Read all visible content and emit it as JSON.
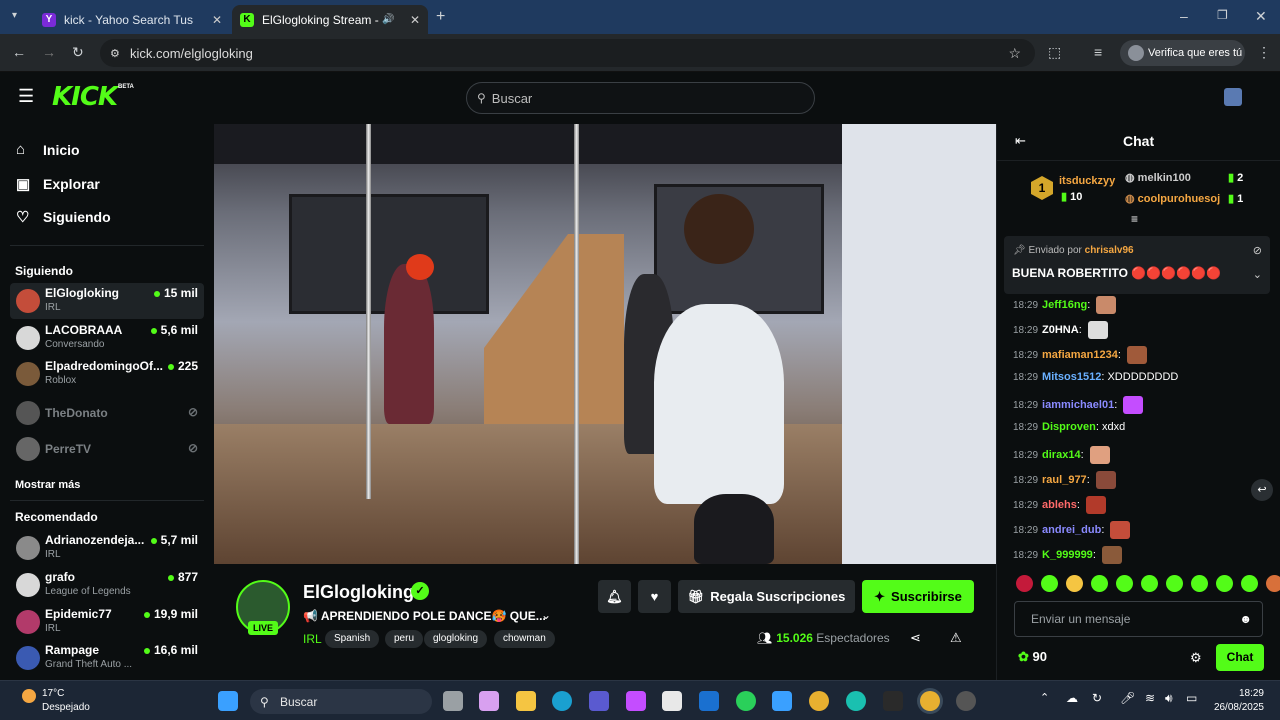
{
  "browser": {
    "tabs": [
      {
        "title": "kick - Yahoo Search Tus resultados",
        "favicon": "Y"
      },
      {
        "title": "ElGlogloking Stream - Watch",
        "favicon": "K"
      }
    ],
    "url": "kick.com/elglogloking",
    "verify_label": "Verifica que eres tú"
  },
  "header": {
    "logo": "KICK",
    "beta": "BETA",
    "search_placeholder": "Buscar"
  },
  "sidebar": {
    "nav": [
      {
        "label": "Inicio",
        "icon": "home-icon"
      },
      {
        "label": "Explorar",
        "icon": "explore-icon"
      },
      {
        "label": "Siguiendo",
        "icon": "heart-icon"
      }
    ],
    "following_title": "Siguiendo",
    "following": [
      {
        "name": "ElGlogloking",
        "category": "IRL",
        "viewers": "15 mil",
        "color": "#c44d3a"
      },
      {
        "name": "LACOBRAAA",
        "category": "Conversando",
        "viewers": "5,6 mil",
        "color": "#d8d8d8"
      },
      {
        "name": "ElpadredomingoOf...",
        "category": "Roblox",
        "viewers": "225",
        "color": "#7a5a3a"
      },
      {
        "name": "TheDonato",
        "category": "",
        "viewers": "",
        "color": "#555"
      },
      {
        "name": "PerreTV",
        "category": "",
        "viewers": "",
        "color": "#666"
      }
    ],
    "show_more": "Mostrar más",
    "recommended_title": "Recomendado",
    "recommended": [
      {
        "name": "Adrianozendeja...",
        "category": "IRL",
        "viewers": "5,7 mil",
        "color": "#8a8a8a"
      },
      {
        "name": "grafo",
        "category": "League of Legends",
        "viewers": "877",
        "color": "#d8d8d8"
      },
      {
        "name": "Epidemic77",
        "category": "IRL",
        "viewers": "19,9 mil",
        "color": "#b23a6a"
      },
      {
        "name": "Rampage",
        "category": "Grand Theft Auto ...",
        "viewers": "16,6 mil",
        "color": "#3a5ab2"
      }
    ]
  },
  "stream": {
    "name": "ElGlogloking",
    "live": "LIVE",
    "title": "📢 APRENDIENDO POLE DANCE🥵 QUE...",
    "category": "IRL",
    "tags": [
      "Spanish",
      "peru",
      "glogloking",
      "chowman"
    ],
    "gift_label": "Regala Suscripciones",
    "subscribe_label": "Suscribirse",
    "viewers_count": "15.026",
    "viewers_label": "Espectadores"
  },
  "chat": {
    "title": "Chat",
    "top_gifter": {
      "name": "itsduckzyy",
      "count": "10",
      "rank": "1"
    },
    "gifters": [
      {
        "rank": "2",
        "name": "melkin100",
        "count": "2"
      },
      {
        "rank": "3",
        "name": "coolpurohuesoj",
        "count": "1"
      }
    ],
    "pinned": {
      "by_label": "Enviado por",
      "by_user": "chrisalv96",
      "text": "BUENA ROBERTITO 🔴🔴🔴🔴🔴🔴"
    },
    "messages": [
      {
        "time": "18:29",
        "user": "Jeff16ng",
        "text": "",
        "color": "#53fc18",
        "emote": "#c98a6a"
      },
      {
        "time": "18:29",
        "user": "Z0HNA",
        "text": "",
        "color": "#ffffff",
        "emote": "#dddddd"
      },
      {
        "time": "18:29",
        "user": "mafiaman1234",
        "text": "",
        "color": "#f5a742",
        "emote": "#a05a3a"
      },
      {
        "time": "18:29",
        "user": "Mitsos1512",
        "text": "XDDDDDDDD",
        "color": "#6ab0ff",
        "emote": ""
      },
      {
        "time": "18:29",
        "user": "iammichael01",
        "text": "",
        "color": "#8a8aff",
        "emote": "#c44dff"
      },
      {
        "time": "18:29",
        "user": "Disproven",
        "text": "xdxd",
        "color": "#53fc18",
        "emote": ""
      },
      {
        "time": "18:29",
        "user": "dirax14",
        "text": "",
        "color": "#53fc18",
        "emote": "#e0a080"
      },
      {
        "time": "18:29",
        "user": "raul_977",
        "text": "",
        "color": "#f5a742",
        "emote": "#8a4a3a"
      },
      {
        "time": "18:29",
        "user": "ablehs",
        "text": "",
        "color": "#ff6a6a",
        "emote": "#b23a2a"
      },
      {
        "time": "18:29",
        "user": "andrei_dub",
        "text": "",
        "color": "#8a8aff",
        "emote": "#c44d3a"
      },
      {
        "time": "18:29",
        "user": "K_999999",
        "text": "",
        "color": "#53fc18",
        "emote": "#8a5a3a"
      }
    ],
    "input_placeholder": "Enviar un mensaje",
    "points": "90",
    "send_label": "Chat"
  },
  "taskbar": {
    "temp": "17°C",
    "weather": "Despejado",
    "search_placeholder": "Buscar",
    "time": "18:29",
    "date": "26/08/2025"
  }
}
